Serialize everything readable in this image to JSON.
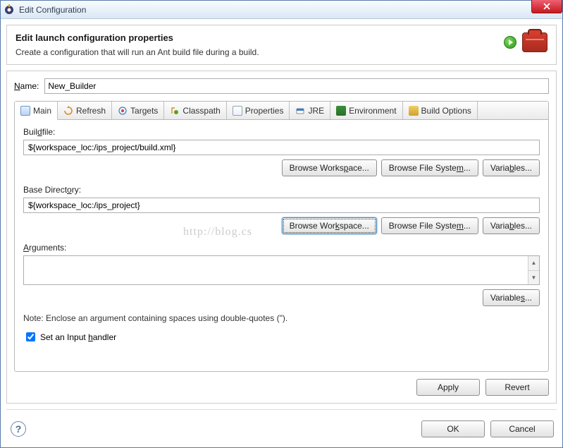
{
  "window": {
    "title": "Edit Configuration"
  },
  "header": {
    "title": "Edit launch configuration properties",
    "subtitle": "Create a configuration that will run an Ant build file during a build."
  },
  "name": {
    "label": "Name:",
    "label_u": "N",
    "value": "New_Builder"
  },
  "tabs": [
    {
      "label": "Main"
    },
    {
      "label": "Refresh"
    },
    {
      "label": "Targets"
    },
    {
      "label": "Classpath"
    },
    {
      "label": "Properties"
    },
    {
      "label": "JRE"
    },
    {
      "label": "Environment"
    },
    {
      "label": "Build Options"
    }
  ],
  "main_tab": {
    "buildfile": {
      "label": "Buildfile:",
      "value": "${workspace_loc:/ips_project/build.xml}",
      "browse_workspace": "Browse Workspace...",
      "browse_filesystem": "Browse File System...",
      "variables": "Variables..."
    },
    "basedir": {
      "label": "Base Directory:",
      "value": "${workspace_loc:/ips_project}",
      "browse_workspace": "Browse Workspace...",
      "browse_filesystem": "Browse File System...",
      "variables": "Variables..."
    },
    "arguments": {
      "label": "Arguments:",
      "value": "",
      "variables": "Variables..."
    },
    "note": "Note: Enclose an argument containing spaces using double-quotes (\").",
    "input_handler": {
      "label": "Set an Input handler",
      "checked": true
    }
  },
  "buttons": {
    "apply": "Apply",
    "revert": "Revert",
    "ok": "OK",
    "cancel": "Cancel"
  },
  "watermark": "http://blog.cs"
}
